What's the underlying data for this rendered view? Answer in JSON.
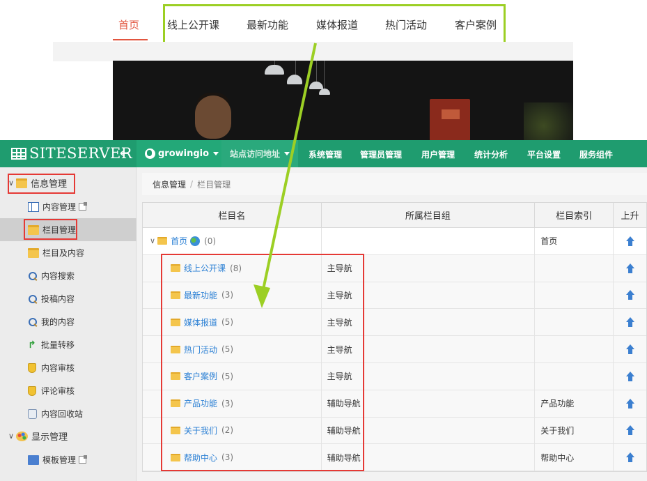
{
  "website": {
    "nav": [
      {
        "label": "首页",
        "active": true
      },
      {
        "label": "线上公开课"
      },
      {
        "label": "最新功能"
      },
      {
        "label": "媒体报道"
      },
      {
        "label": "热门活动"
      },
      {
        "label": "客户案例"
      }
    ]
  },
  "topbar": {
    "logo": "SITESERVER",
    "collapse_glyph": "←",
    "site_name": "growingio",
    "site_url_label": "站点访问地址",
    "menu": [
      "系统管理",
      "管理员管理",
      "用户管理",
      "统计分析",
      "平台设置",
      "服务组件"
    ],
    "color": "#1f9c6f"
  },
  "sidebar": {
    "groups": [
      {
        "label": "信息管理",
        "icon": "folder-icon",
        "items": [
          {
            "label": "内容管理",
            "icon": "columns-icon",
            "external": true
          },
          {
            "label": "栏目管理",
            "icon": "folder-icon",
            "active": true
          },
          {
            "label": "栏目及内容",
            "icon": "folder-icon"
          },
          {
            "label": "内容搜索",
            "icon": "search-icon"
          },
          {
            "label": "投稿内容",
            "icon": "search-icon"
          },
          {
            "label": "我的内容",
            "icon": "search-icon"
          },
          {
            "label": "批量转移",
            "icon": "arrow-icon"
          },
          {
            "label": "内容审核",
            "icon": "shield-icon"
          },
          {
            "label": "评论审核",
            "icon": "shield-icon"
          },
          {
            "label": "内容回收站",
            "icon": "recycle-icon"
          }
        ]
      },
      {
        "label": "显示管理",
        "icon": "palette-icon",
        "items": [
          {
            "label": "模板管理",
            "icon": "template-icon",
            "external": true
          }
        ]
      }
    ]
  },
  "breadcrumb": [
    "信息管理",
    "栏目管理"
  ],
  "breadcrumb_separator": "/",
  "table": {
    "columns": [
      "栏目名",
      "所属栏目组",
      "栏目索引",
      "上升"
    ],
    "rows": [
      {
        "name": "首页",
        "count": "(0)",
        "group": "",
        "index": "首页",
        "level": 0
      },
      {
        "name": "线上公开课",
        "count": "(8)",
        "group": "主导航",
        "index": "",
        "level": 1
      },
      {
        "name": "最新功能",
        "count": "(3)",
        "group": "主导航",
        "index": "",
        "level": 1
      },
      {
        "name": "媒体报道",
        "count": "(5)",
        "group": "主导航",
        "index": "",
        "level": 1
      },
      {
        "name": "热门活动",
        "count": "(5)",
        "group": "主导航",
        "index": "",
        "level": 1
      },
      {
        "name": "客户案例",
        "count": "(5)",
        "group": "主导航",
        "index": "",
        "level": 1
      },
      {
        "name": "产品功能",
        "count": "(3)",
        "group": "辅助导航",
        "index": "产品功能",
        "level": 1
      },
      {
        "name": "关于我们",
        "count": "(2)",
        "group": "辅助导航",
        "index": "关于我们",
        "level": 1
      },
      {
        "name": "帮助中心",
        "count": "(3)",
        "group": "辅助导航",
        "index": "帮助中心",
        "level": 1
      }
    ]
  },
  "annotation_colors": {
    "highlight": "#9ccf24",
    "red_box": "#e53935"
  }
}
